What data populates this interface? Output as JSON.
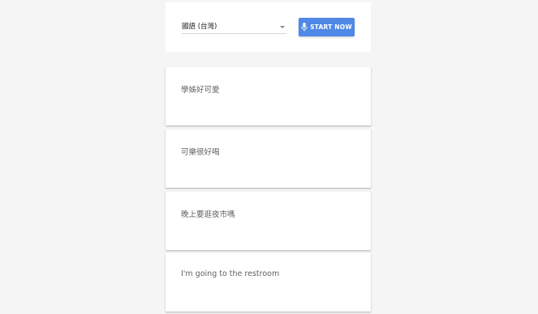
{
  "controls": {
    "language_selected": "國語 (台灣)",
    "start_button_label": "START NOW"
  },
  "phrases": [
    "學姊好可愛",
    "可樂很好喝",
    "晚上要逛夜市嗎",
    "I'm going to the restroom"
  ],
  "colors": {
    "background": "#f5f5f5",
    "card": "#ffffff",
    "accent": "#4f88e7",
    "phrase_text": "#616161"
  }
}
